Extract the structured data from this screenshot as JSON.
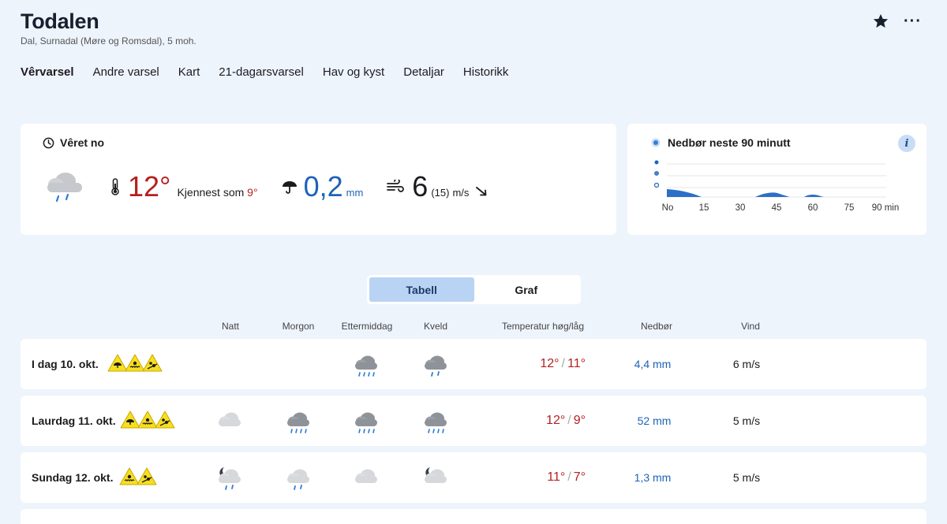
{
  "location": {
    "name": "Todalen",
    "subtitle": "Dal, Surnadal (Møre og Romsdal), 5 moh."
  },
  "nav": [
    "Vêrvarsel",
    "Andre varsel",
    "Kart",
    "21-dagarsvarsel",
    "Hav og kyst",
    "Detaljar",
    "Historikk"
  ],
  "now": {
    "title": "Vêret no",
    "temperature": "12°",
    "feels_label": "Kjennest som",
    "feels_value": "9°",
    "precip": "0,2",
    "precip_unit": "mm",
    "wind": "6",
    "gust": "(15)",
    "wind_unit": "m/s"
  },
  "nowcast": {
    "title": "Nedbør neste 90 minutt",
    "info": "i",
    "ticks": [
      "No",
      "15",
      "30",
      "45",
      "60",
      "75",
      "90 min"
    ]
  },
  "view_toggle": {
    "table": "Tabell",
    "graph": "Graf"
  },
  "columns": {
    "natt": "Natt",
    "morgon": "Morgon",
    "ettermiddag": "Ettermiddag",
    "kveld": "Kveld",
    "temp": "Temperatur høg/låg",
    "precip": "Nedbør",
    "wind": "Vind"
  },
  "days": [
    {
      "label": "I dag 10. okt.",
      "hi": "12°",
      "lo": "11°",
      "precip": "4,4 mm",
      "wind": "6 m/s"
    },
    {
      "label": "Laurdag 11. okt.",
      "hi": "12°",
      "lo": "9°",
      "precip": "52 mm",
      "wind": "5 m/s"
    },
    {
      "label": "Sundag 12. okt.",
      "hi": "11°",
      "lo": "7°",
      "precip": "1,3 mm",
      "wind": "5 m/s"
    }
  ],
  "colors": {
    "warm": "#b51f1f",
    "rain": "#1d63b8",
    "background": "#eef4fc",
    "warning": "#f7df1e"
  },
  "icons": {
    "weather": [
      "rain-cloud-icon",
      "heavy-rain-cloud-icon",
      "cloud-icon",
      "moon-cloud-rain-icon",
      "moon-cloud-icon"
    ],
    "warnings": [
      "umbrella-warning-icon",
      "flood-warning-icon",
      "landslide-warning-icon"
    ]
  }
}
